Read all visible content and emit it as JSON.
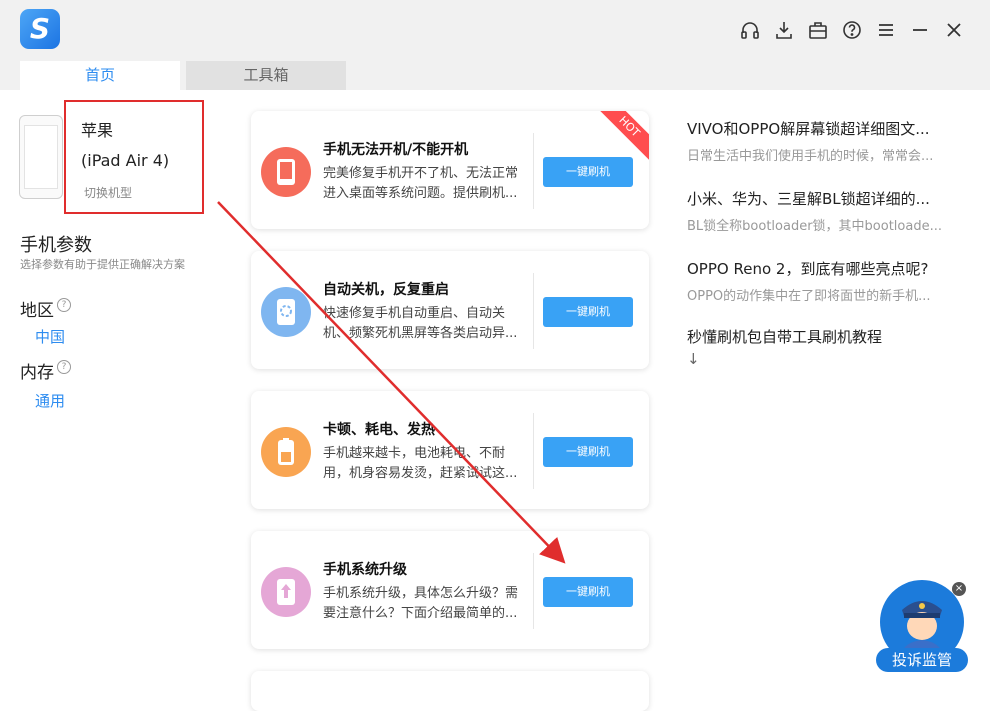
{
  "app": {
    "logo_letter": "S"
  },
  "tabs": [
    {
      "label": "首页",
      "active": true
    },
    {
      "label": "工具箱",
      "active": false
    }
  ],
  "toolbar_icons": [
    "headset-icon",
    "download-icon",
    "toolbox-icon",
    "help-icon",
    "menu-icon",
    "minimize-icon",
    "close-icon"
  ],
  "device": {
    "brand": "苹果",
    "model": "(iPad Air 4)",
    "switch_label": "切换机型"
  },
  "params": {
    "title": "手机参数",
    "subtitle": "选择参数有助于提供正确解决方案",
    "region_label": "地区",
    "region_value": "中国",
    "memory_label": "内存",
    "memory_value": "通用",
    "help_glyph": "?"
  },
  "cards": [
    {
      "title": "手机无法开机/不能开机",
      "desc": "完美修复手机开不了机、无法正常进入桌面等系统问题。提供刷机...",
      "button": "一键刷机",
      "badge": "HOT",
      "color": "#f56c5b"
    },
    {
      "title": "自动关机，反复重启",
      "desc": "快速修复手机自动重启、自动关机、频繁死机黑屏等各类启动异...",
      "button": "一键刷机",
      "color": "#7fb6f0"
    },
    {
      "title": "卡顿、耗电、发热",
      "desc": "手机越来越卡，电池耗电、不耐用，机身容易发烫，赶紧试试这...",
      "button": "一键刷机",
      "color": "#f9a552"
    },
    {
      "title": "手机系统升级",
      "desc": "手机系统升级，具体怎么升级？需要注意什么？下面介绍最简单的...",
      "button": "一键刷机",
      "color": "#e5a7d6"
    }
  ],
  "articles": [
    {
      "title": "VIVO和OPPO解屏幕锁超详细图文...",
      "subtitle": "日常生活中我们使用手机的时候，常常会..."
    },
    {
      "title": "小米、华为、三星解BL锁超详细的...",
      "subtitle": "BL锁全称bootloader锁，其中bootloade..."
    },
    {
      "title": "OPPO Reno 2，到底有哪些亮点呢?",
      "subtitle": "OPPO的动作集中在了即将面世的新手机..."
    },
    {
      "title": "秒懂刷机包自带工具刷机教程",
      "subtitle": ""
    }
  ],
  "more_arrow": "↓",
  "complaint": {
    "label": "投诉监管",
    "close": "×"
  },
  "colors": {
    "accent": "#2d8cf0",
    "button": "#39a2f5",
    "annotation": "#e02d2d"
  }
}
